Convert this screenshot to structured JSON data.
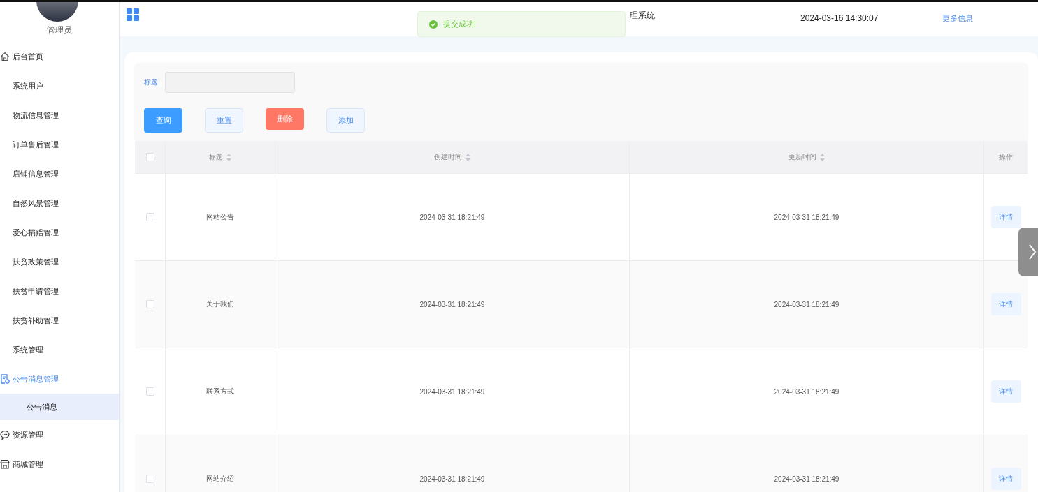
{
  "sidebar": {
    "user": {
      "name": "管理员"
    },
    "items": [
      {
        "label": "后台首页",
        "selected": false
      },
      {
        "label": "系统用户",
        "selected": false
      },
      {
        "label": "物流信息管理",
        "selected": false
      },
      {
        "label": "订单售后管理",
        "selected": false
      },
      {
        "label": "店铺信息管理",
        "selected": false
      },
      {
        "label": "自然风景管理",
        "selected": false
      },
      {
        "label": "爱心捐赠管理",
        "selected": false
      },
      {
        "label": "扶贫政策管理",
        "selected": false
      },
      {
        "label": "扶贫申请管理",
        "selected": false
      },
      {
        "label": "扶贫补助管理",
        "selected": false
      },
      {
        "label": "系统管理",
        "selected": false
      },
      {
        "label": "公告消息管理",
        "selected": true,
        "children": [
          {
            "label": "公告消息",
            "selected": true
          }
        ]
      },
      {
        "label": "资源管理",
        "selected": false
      },
      {
        "label": "商城管理",
        "selected": false
      }
    ]
  },
  "header": {
    "title": "理系统",
    "datetime": "2024-03-16 14:30:07",
    "more_link": "更多信息"
  },
  "toast": {
    "kind": "success",
    "message": "提交成功!"
  },
  "search": {
    "label": "标题"
  },
  "buttons": [
    {
      "label": "查询",
      "kind": "primary"
    },
    {
      "label": "重置",
      "kind": "plain"
    },
    {
      "label": "删除",
      "kind": "danger"
    },
    {
      "label": "添加",
      "kind": "plain"
    }
  ],
  "table": {
    "columns": [
      "标题",
      "创建时间",
      "更新时间",
      "操作"
    ],
    "header_checked": false,
    "rows": [
      {
        "checked": false,
        "title": "网站公告",
        "created": "2024-03-31 18:21:49",
        "updated": "2024-03-31 18:21:49",
        "action": "详情"
      },
      {
        "checked": false,
        "title": "关于我们",
        "created": "2024-03-31 18:21:49",
        "updated": "2024-03-31 18:21:49",
        "action": "详情"
      },
      {
        "checked": false,
        "title": "联系方式",
        "created": "2024-03-31 18:21:49",
        "updated": "2024-03-31 18:21:49",
        "action": "详情"
      },
      {
        "checked": false,
        "title": "网站介绍",
        "created": "2024-03-31 18:21:49",
        "updated": "2024-03-31 18:21:49",
        "action": "详情"
      }
    ]
  }
}
